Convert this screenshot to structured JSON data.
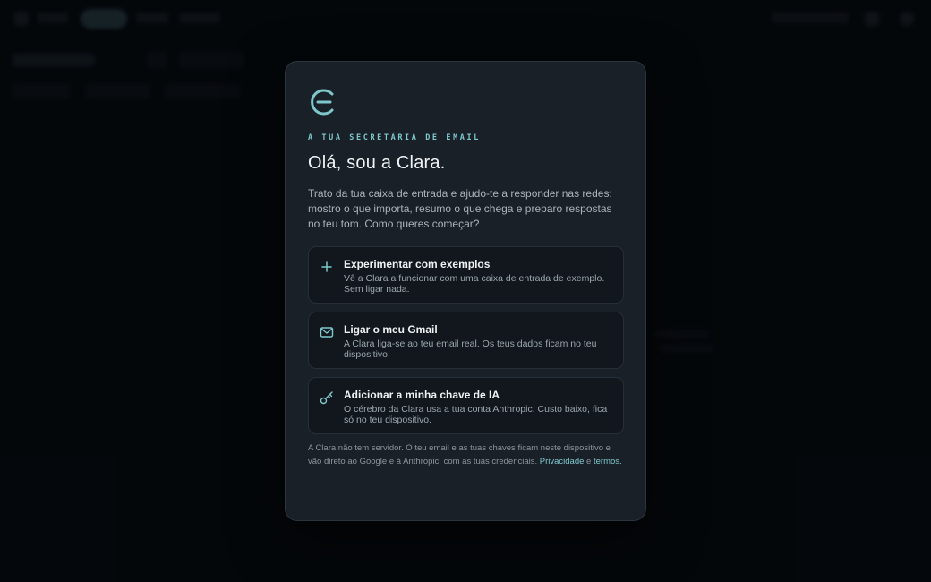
{
  "modal": {
    "eyebrow": "A TUA SECRETÁRIA DE EMAIL",
    "title": "Olá, sou a Clara.",
    "intro": "Trato da tua caixa de entrada e ajudo-te a responder nas redes: mostro o que importa, resumo o que chega e preparo respostas no teu tom. Como queres começar?",
    "options": [
      {
        "icon": "plus-icon",
        "title": "Experimentar com exemplos",
        "description": "Vê a Clara a funcionar com uma caixa de entrada de exemplo. Sem ligar nada."
      },
      {
        "icon": "mail-icon",
        "title": "Ligar o meu Gmail",
        "description": "A Clara liga-se ao teu email real. Os teus dados ficam no teu dispositivo."
      },
      {
        "icon": "key-icon",
        "title": "Adicionar a minha chave de IA",
        "description": "O cérebro da Clara usa a tua conta Anthropic. Custo baixo, fica só no teu dispositivo."
      }
    ],
    "footer": {
      "text": "A Clara não tem servidor. O teu email e as tuas chaves ficam neste dispositivo e vão direto ao Google e à Anthropic, com as tuas credenciais.",
      "link_privacy": "Privacidade",
      "connector": "e",
      "link_terms": "termos."
    }
  },
  "colors": {
    "accent": "#7ec8cc",
    "modal_bg": "#1a2028",
    "card_bg": "#12171d",
    "page_bg": "#05090d"
  }
}
